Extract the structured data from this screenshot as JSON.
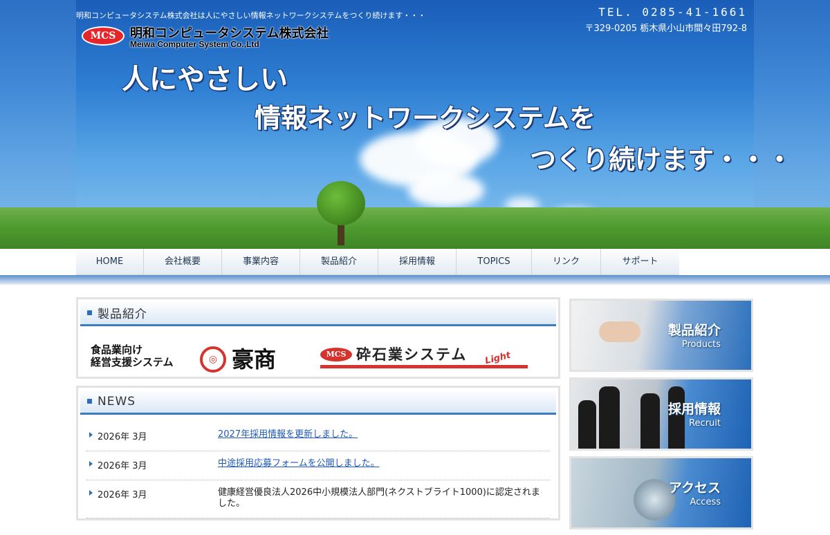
{
  "header": {
    "tagline": "明和コンピュータシステム株式会社は人にやさしい情報ネットワークシステムをつくり続けます・・・",
    "logo_badge": "MCS",
    "company_jp": "明和コンピュータシステム株式会社",
    "company_en": "Meiwa Computer System Co.,Ltd",
    "tel": "TEL. 0285-41-1661",
    "address": "〒329-0205 栃木県小山市間々田792-8"
  },
  "hero": {
    "line1": "人にやさしい",
    "line2": "情報ネットワークシステムを",
    "line3": "つくり続けます・・・"
  },
  "nav": {
    "items": [
      {
        "label": "HOME"
      },
      {
        "label": "会社概要"
      },
      {
        "label": "事業内容"
      },
      {
        "label": "製品紹介"
      },
      {
        "label": "採用情報"
      },
      {
        "label": "TOPICS"
      },
      {
        "label": "リンク"
      },
      {
        "label": "サポート"
      }
    ]
  },
  "products": {
    "title": "製品紹介",
    "item1_desc_line1": "食品業向け",
    "item1_desc_line2": "経営支援システム",
    "item1_name": "豪商",
    "item2_badge": "MCS",
    "item2_name": "砕石業システム",
    "item2_suffix": "Light"
  },
  "news": {
    "title": "NEWS",
    "items": [
      {
        "date": "2026年 3月",
        "text": "2027年採用情報を更新しました。",
        "link": true
      },
      {
        "date": "2026年 3月",
        "text": "中途採用応募フォームを公開しました。",
        "link": true
      },
      {
        "date": "2026年 3月",
        "text": "健康経営優良法人2026中小規模法人部門(ネクストブライト1000)に認定されました。",
        "link": false
      }
    ]
  },
  "sidebar": {
    "banners": [
      {
        "jp": "製品紹介",
        "en": "Products"
      },
      {
        "jp": "採用情報",
        "en": "Recruit"
      },
      {
        "jp": "アクセス",
        "en": "Access"
      }
    ]
  }
}
